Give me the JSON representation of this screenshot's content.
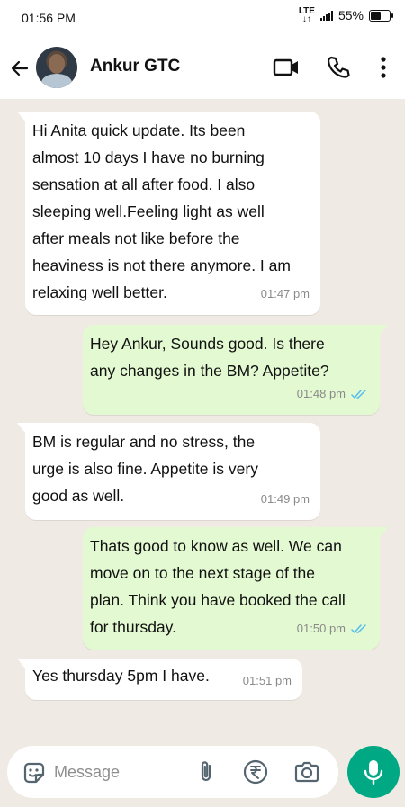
{
  "status": {
    "time": "01:56 PM",
    "network": "LTE",
    "battery": "55%",
    "battery_level": 0.55
  },
  "header": {
    "contact_name": "Ankur GTC"
  },
  "messages": [
    {
      "dir": "in",
      "text": " Hi Anita quick update. Its been\nalmost 10 days I have no burning\nsensation at all after food. I also\nsleeping well.Feeling light as well\nafter meals not like before the\nheaviness is not there anymore. I am\nrelaxing well better.",
      "time": "01:47 pm"
    },
    {
      "dir": "out",
      "text": " Hey Ankur, Sounds good. Is there\nany changes in the BM? Appetite?",
      "time": "01:48 pm",
      "read": true
    },
    {
      "dir": "in",
      "text": " BM is regular and no stress, the\nurge is also fine. Appetite is very\ngood as well.",
      "time": "01:49 pm"
    },
    {
      "dir": "out",
      "text": " Thats good to know as well. We can\nmove on to the next stage of the\nplan. Think you have booked the call\nfor thursday.",
      "time": "01:50 pm",
      "read": true
    },
    {
      "dir": "in",
      "text": " Yes thursday 5pm I have.",
      "time": "01:51 pm"
    }
  ],
  "composer": {
    "placeholder": "Message"
  },
  "colors": {
    "accent": "#00a884",
    "outgoing_bubble": "#e3f9d1",
    "incoming_bubble": "#ffffff",
    "read_ticks": "#53bdeb"
  },
  "icons": [
    "arrow-left-icon",
    "video-icon",
    "phone-icon",
    "more-vertical-icon",
    "emoji-sticker-icon",
    "attach-icon",
    "rupee-icon",
    "camera-icon",
    "mic-icon",
    "double-tick-icon"
  ]
}
